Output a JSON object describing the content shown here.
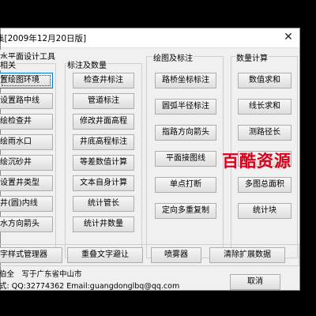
{
  "window": {
    "title": "集[2009年12月20日版]",
    "close_glyph": "✕"
  },
  "groups": {
    "setup": {
      "label": "水平面设计工具",
      "sublabel": "相关",
      "buttons": [
        "置绘图环境",
        "设置路中线",
        "绘检查井",
        "绘雨水口",
        "绘沉砂井",
        "设置井类型",
        "井(圆)内线",
        "水方向箭头"
      ]
    },
    "annotate": {
      "label": "标注及数量",
      "buttons": [
        "检查井标注",
        "管道标注",
        "修改井面高程",
        "井底高程标注",
        "等差数值计算",
        "文本自身计算",
        "统计管长",
        "统计井数量"
      ]
    },
    "drawing": {
      "label": "绘图及标注",
      "buttons": [
        "路桥坐标标注",
        "圆弧半径标注",
        "指路方向箭头",
        "平面接图线",
        "单点打断",
        "定向多重复制"
      ]
    },
    "calc": {
      "label": "数量计算",
      "buttons": [
        "数值求和",
        "线长求和",
        "测路径长",
        "",
        "多图总面积",
        "统计块"
      ]
    }
  },
  "bottom_buttons": [
    "字样式管理器",
    "重叠文字避让",
    "喷雾器",
    "清除扩展数据"
  ],
  "info": {
    "author": "伯全　写于广东省中山市",
    "contact": "式: QQ:32774362 Email:guangdonglbq@qq.com"
  },
  "cancel_label": "取消",
  "watermark": "百酷资源"
}
